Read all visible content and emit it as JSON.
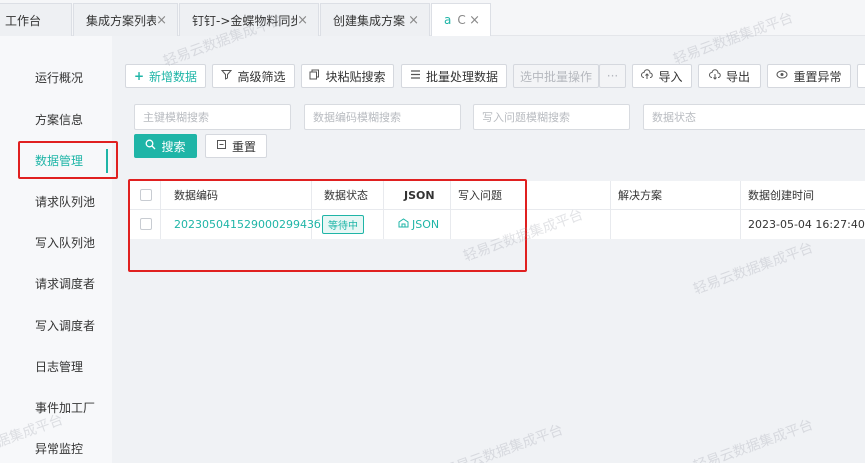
{
  "tabs": [
    {
      "label": "工作台",
      "closable": false
    },
    {
      "label": "集成方案列表",
      "closable": true
    },
    {
      "label": "钉钉->金蝶物料同步",
      "closable": true
    },
    {
      "label": "创建集成方案",
      "closable": true
    },
    {
      "label": "a",
      "refresh": "C",
      "closable": true
    }
  ],
  "sidebar": {
    "items": [
      {
        "label": "运行概况"
      },
      {
        "label": "方案信息"
      },
      {
        "label": "数据管理",
        "active": true
      },
      {
        "label": "请求队列池"
      },
      {
        "label": "写入队列池"
      },
      {
        "label": "请求调度者"
      },
      {
        "label": "写入调度者"
      },
      {
        "label": "日志管理"
      },
      {
        "label": "事件加工厂"
      },
      {
        "label": "异常监控"
      }
    ]
  },
  "toolbar": {
    "add_label": "新增数据",
    "filter_label": "高级筛选",
    "paste_label": "块粘贴搜索",
    "batch_label": "批量处理数据",
    "selected_batch_label": "选中批量操作",
    "more_label": "···",
    "import_label": "导入",
    "export_label": "导出",
    "reset_error_label": "重置异常"
  },
  "search": {
    "pk_placeholder": "主键模糊搜索",
    "code_placeholder": "数据编码模糊搜索",
    "issue_placeholder": "写入问题模糊搜索",
    "status_placeholder": "数据状态",
    "search_label": "搜索",
    "reset_label": "重置"
  },
  "table": {
    "headers": {
      "code": "数据编码",
      "status": "数据状态",
      "json": "JSON",
      "issue": "写入问题",
      "solution": "解决方案",
      "created": "数据创建时间"
    },
    "rows": [
      {
        "code": "20230504152900029943б",
        "status": "等待中",
        "json": "JSON",
        "issue": "",
        "solution": "",
        "created": "2023-05-04 16:27:40"
      }
    ]
  },
  "watermark": "轻易云数据集成平台",
  "colors": {
    "accent": "#1fb5a7",
    "highlight": "#e02020"
  }
}
